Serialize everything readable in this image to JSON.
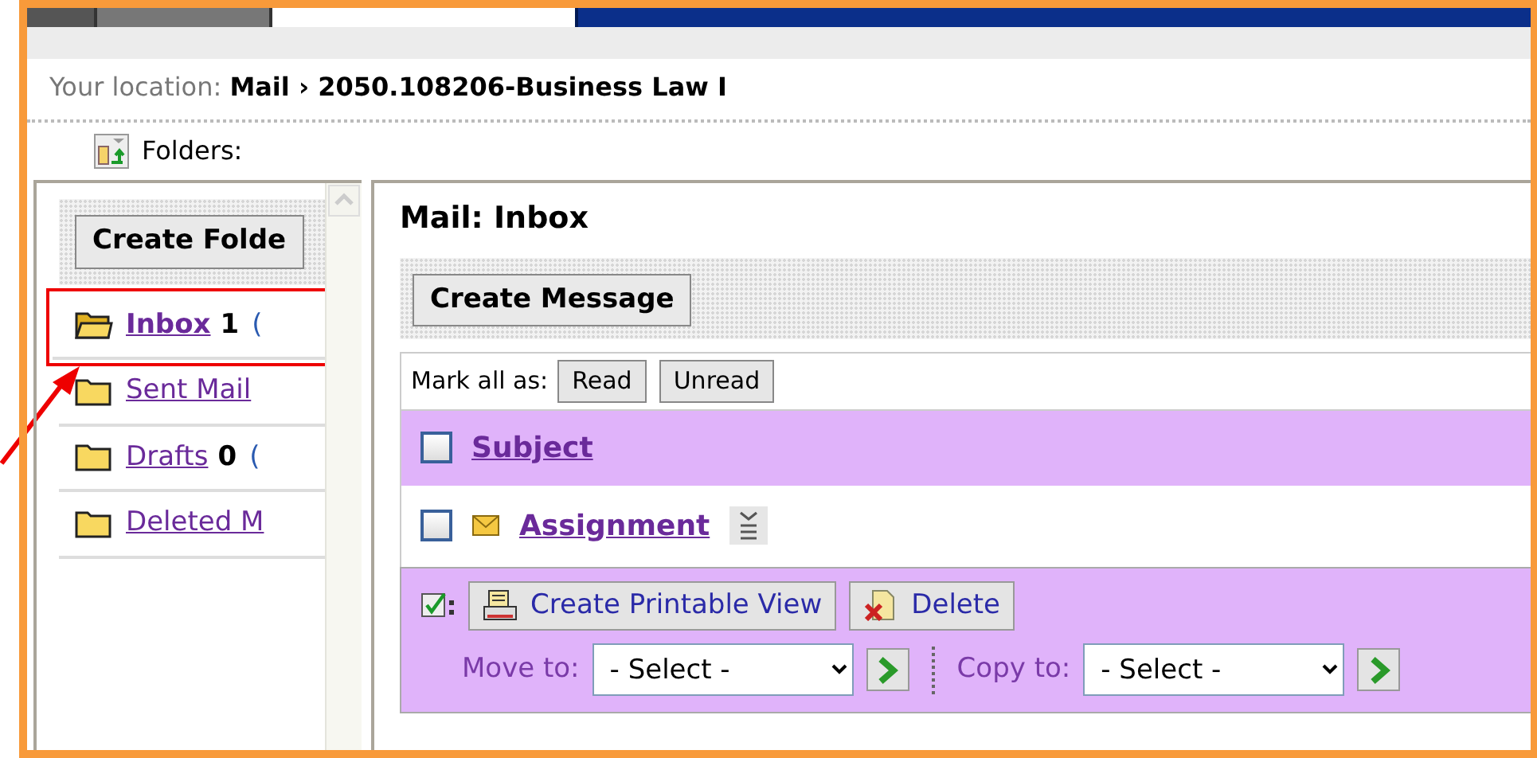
{
  "location": {
    "label": "Your location:",
    "path": "Mail › 2050.108206-Business Law I"
  },
  "folders_toggle": {
    "label": "Folders:"
  },
  "sidebar": {
    "create_button": "Create Folde",
    "folders": [
      {
        "name": "Inbox",
        "count": "1",
        "suffix": "(",
        "selected": true,
        "highlighted": true
      },
      {
        "name": "Sent Mail",
        "selected": false,
        "highlighted": false
      },
      {
        "name": "Drafts",
        "count": "0",
        "suffix": "(",
        "selected": false,
        "highlighted": false
      },
      {
        "name": "Deleted M",
        "selected": false,
        "highlighted": false
      }
    ]
  },
  "main": {
    "title": "Mail: Inbox",
    "create_button": "Create Message",
    "mark_all_label": "Mark all as:",
    "mark_buttons": [
      "Read",
      "Unread"
    ],
    "header": {
      "subject": "Subject",
      "checked": false
    },
    "messages": [
      {
        "subject": "Assignment",
        "checked": false
      }
    ],
    "actions": {
      "buttons": [
        {
          "label": "Create Printable View",
          "kind": "print"
        },
        {
          "label": "Delete",
          "kind": "delete"
        }
      ],
      "move": {
        "label": "Move to:",
        "value": "- Select -"
      },
      "copy": {
        "label": "Copy to:",
        "value": "- Select -"
      }
    }
  }
}
